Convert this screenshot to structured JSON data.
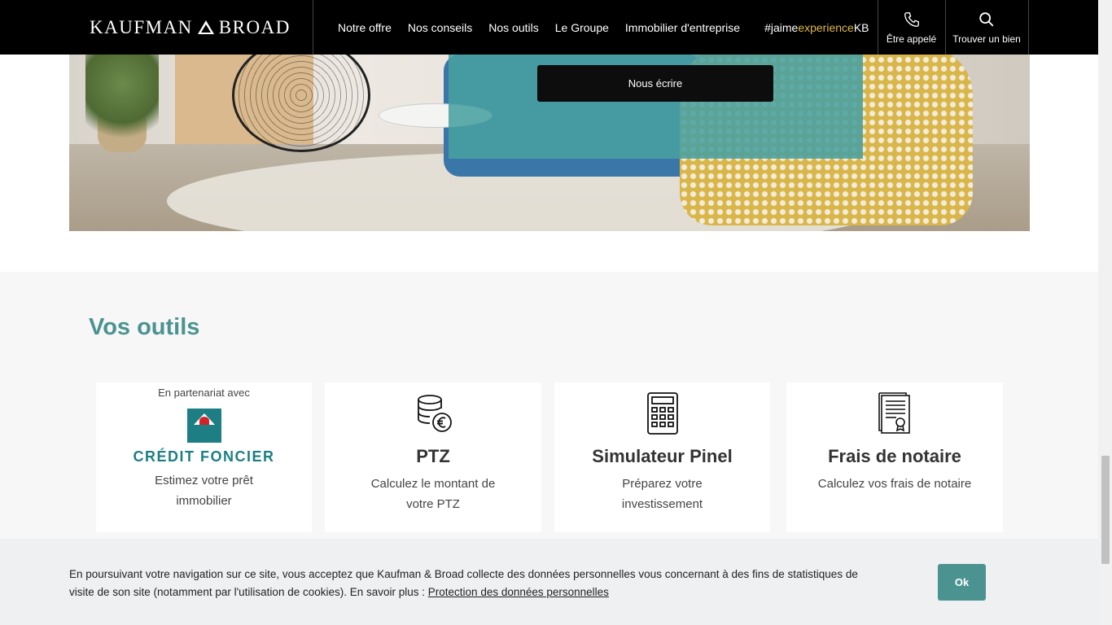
{
  "header": {
    "brand_left": "KAUFMAN",
    "brand_right": "BROAD",
    "nav": [
      {
        "label": "Notre offre"
      },
      {
        "label": "Nos conseils"
      },
      {
        "label": "Nos outils"
      },
      {
        "label": "Le Groupe"
      },
      {
        "label": "Immobilier d'entreprise"
      }
    ],
    "hashtag": {
      "part1": "#jaime",
      "part2": "experience",
      "part3": "KB"
    },
    "actions": {
      "call_label": "Être appelé",
      "find_label": "Trouver un bien"
    }
  },
  "hero": {
    "write_label": "Nous écrire"
  },
  "tools": {
    "title": "Vos outils",
    "cards": [
      {
        "partner_label": "En partenariat avec",
        "partner_name": "CRÉDIT FONCIER",
        "desc": "Estimez votre prêt immobilier",
        "icon": "credit-foncier-logo"
      },
      {
        "title": "PTZ",
        "desc": "Calculez le montant de votre PTZ",
        "icon": "coins-euro-icon"
      },
      {
        "title": "Simulateur Pinel",
        "desc": "Préparez votre investissement",
        "icon": "calculator-icon"
      },
      {
        "title": "Frais de notaire",
        "desc": "Calculez vos frais de notaire",
        "icon": "certificate-document-icon"
      }
    ]
  },
  "cookie": {
    "text": "En poursuivant votre navigation sur ce site, vous acceptez que Kaufman & Broad collecte des données personnelles vous concernant à des fins de statistiques de visite de son site (notamment par l'utilisation de cookies). En savoir plus : ",
    "link": "Protection des données personnelles",
    "ok": "Ok"
  },
  "colors": {
    "accent": "#4a9390",
    "header_bg": "#000000",
    "hashtag_highlight": "#e0b84a"
  }
}
